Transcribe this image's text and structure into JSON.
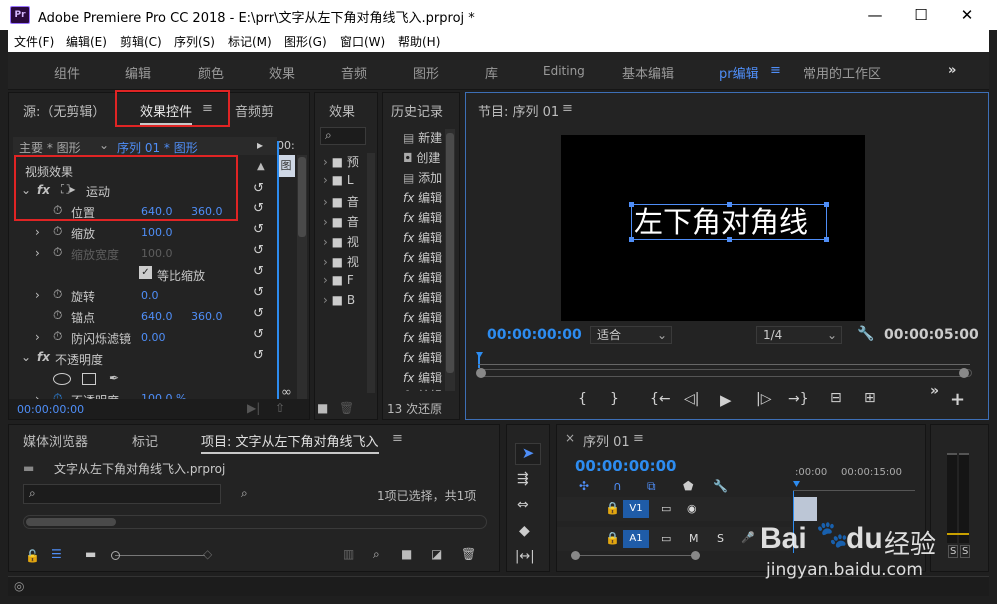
{
  "window": {
    "title": "Adobe Premiere Pro CC 2018 - E:\\prr\\文字从左下角对角线飞入.prproj *",
    "app_icon": "Pr",
    "minimize": "—",
    "maximize": "☐",
    "close": "✕"
  },
  "menubar": [
    "文件(F)",
    "编辑(E)",
    "剪辑(C)",
    "序列(S)",
    "标记(M)",
    "图形(G)",
    "窗口(W)",
    "帮助(H)"
  ],
  "workspaces": {
    "items": [
      "组件",
      "编辑",
      "颜色",
      "效果",
      "音频",
      "图形",
      "库",
      "Editing",
      "基本编辑",
      "pr编辑",
      "常用的工作区"
    ],
    "active": "pr编辑",
    "overflow": "»"
  },
  "effect_controls": {
    "tabs": [
      "源:（无剪辑）",
      "效果控件",
      "音频剪"
    ],
    "active_tab": "效果控件",
    "master_label": "主要 * 图形",
    "sequence_label": "序列 01 * 图形",
    "timeline_marker": "00:",
    "clip_label": "图",
    "video_effects": "视频效果",
    "motion": "运动",
    "position_label": "位置",
    "position_x": "640.0",
    "position_y": "360.0",
    "scale_label": "缩放",
    "scale_value": "100.0",
    "scale_width_label": "缩放宽度",
    "scale_width_value": "100.0",
    "uniform_scale_label": "等比缩放",
    "rotation_label": "旋转",
    "rotation_value": "0.0",
    "anchor_label": "锚点",
    "anchor_x": "640.0",
    "anchor_y": "360.0",
    "flicker_label": "防闪烁滤镜",
    "flicker_value": "0.00",
    "opacity_label": "不透明度",
    "opacity_partial_label": "不透明度",
    "opacity_partial_value": "100.0 %",
    "timecode": "00:00:00:00"
  },
  "effects_panel": {
    "tab": "效果",
    "folders": [
      "预",
      "L",
      "音",
      "音",
      "视",
      "视",
      "F",
      "B"
    ]
  },
  "history_panel": {
    "tab": "历史记录",
    "items": [
      "新建",
      "创建",
      "添加",
      "编辑",
      "编辑",
      "编辑",
      "编辑",
      "编辑",
      "编辑",
      "编辑",
      "编辑",
      "编辑",
      "编辑",
      "编辑"
    ],
    "footer": "13 次还原"
  },
  "program_monitor": {
    "title": "节目: 序列 01",
    "overlay_text": "左下角对角线",
    "timecode": "00:00:00:00",
    "fit": "适合",
    "quality": "1/4",
    "duration": "00:00:05:00",
    "controls": [
      "{",
      "}",
      "{←",
      "◁|",
      "▶",
      "|▷",
      "→}"
    ],
    "extra": "»",
    "add": "+"
  },
  "project_panel": {
    "tabs": [
      "媒体浏览器",
      "标记",
      "项目: 文字从左下角对角线飞入"
    ],
    "active_tab": "项目: 文字从左下角对角线飞入",
    "filename": "文字从左下角对角线飞入.prproj",
    "selection_info": "1项已选择，共1项"
  },
  "tools": [
    "select",
    "track-select",
    "ripple",
    "razor",
    "slip"
  ],
  "timeline": {
    "title": "序列 01",
    "close": "×",
    "timecode": "00:00:00:00",
    "ruler": [
      ":00:00",
      "00:00:15:00"
    ],
    "tracks": [
      {
        "name": "V1",
        "toggles": [
          "▭",
          "◉"
        ]
      },
      {
        "name": "A1",
        "toggles": [
          "▭",
          "M",
          "S",
          "🎤"
        ]
      }
    ]
  },
  "audio_meter": {
    "labels": [
      "S",
      "S"
    ]
  },
  "watermark": {
    "brand": "Bai",
    "brand2": "du",
    "brand3": "经验",
    "url": "jingyan.baidu.com"
  },
  "colors": {
    "accent": "#2d8cf0",
    "highlight_box": "#e02424",
    "panel_bg": "#232323"
  }
}
